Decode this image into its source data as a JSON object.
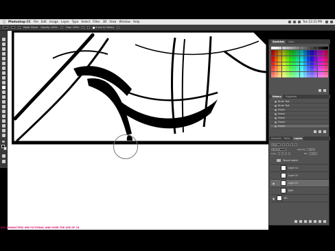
{
  "menubar": {
    "app_name": "Photoshop CC",
    "items": [
      "File",
      "Edit",
      "Image",
      "Layer",
      "Type",
      "Select",
      "Filter",
      "3D",
      "View",
      "Window",
      "Help"
    ],
    "clock": "Tue 12:31 PM"
  },
  "options_bar": {
    "mode_label": "Mode:",
    "mode_value": "Brush",
    "opacity_label": "Opacity:",
    "opacity_value": "100%",
    "flow_label": "Flow:",
    "flow_value": "100%",
    "erase_history_label": "Erase to History"
  },
  "panels": {
    "swatches": {
      "tabs": [
        "Swatches",
        "Color"
      ]
    },
    "history": {
      "tabs": [
        "History",
        "Properties"
      ],
      "items": [
        "Brush Tool",
        "Brush Tool",
        "Eraser",
        "Eraser",
        "Eraser",
        "Eraser",
        "Eraser"
      ],
      "active_index": 6
    },
    "layers": {
      "tabs": [
        "Channels",
        "Paths",
        "Layers"
      ],
      "kind_label": "Kind",
      "blend_mode": "Normal",
      "opacity_label": "Opacity:",
      "opacity_value": "100%",
      "lock_label": "Lock:",
      "fill_label": "Fill:",
      "fill_value": "100%",
      "rows": [
        {
          "name": "Tatsuki sketch",
          "type": "group",
          "visible": false
        },
        {
          "name": "Layer 14",
          "type": "layer",
          "visible": false
        },
        {
          "name": "Layer 15",
          "type": "layer",
          "visible": false
        },
        {
          "name": "Layer 13",
          "type": "layer",
          "visible": true,
          "active": true
        },
        {
          "name": "BAM",
          "type": "layer",
          "visible": false
        },
        {
          "name": "BG",
          "type": "layer",
          "visible": true
        }
      ]
    }
  },
  "disclaimer": "ALL CHARACTERS ARE FICTIONAL AND OVER THE AGE OF 18",
  "colors": {
    "menubar": "#e6e6e6",
    "app_chrome": "#535353",
    "dark_chrome": "#3a3a3a",
    "disclaimer": "#e0106a"
  }
}
